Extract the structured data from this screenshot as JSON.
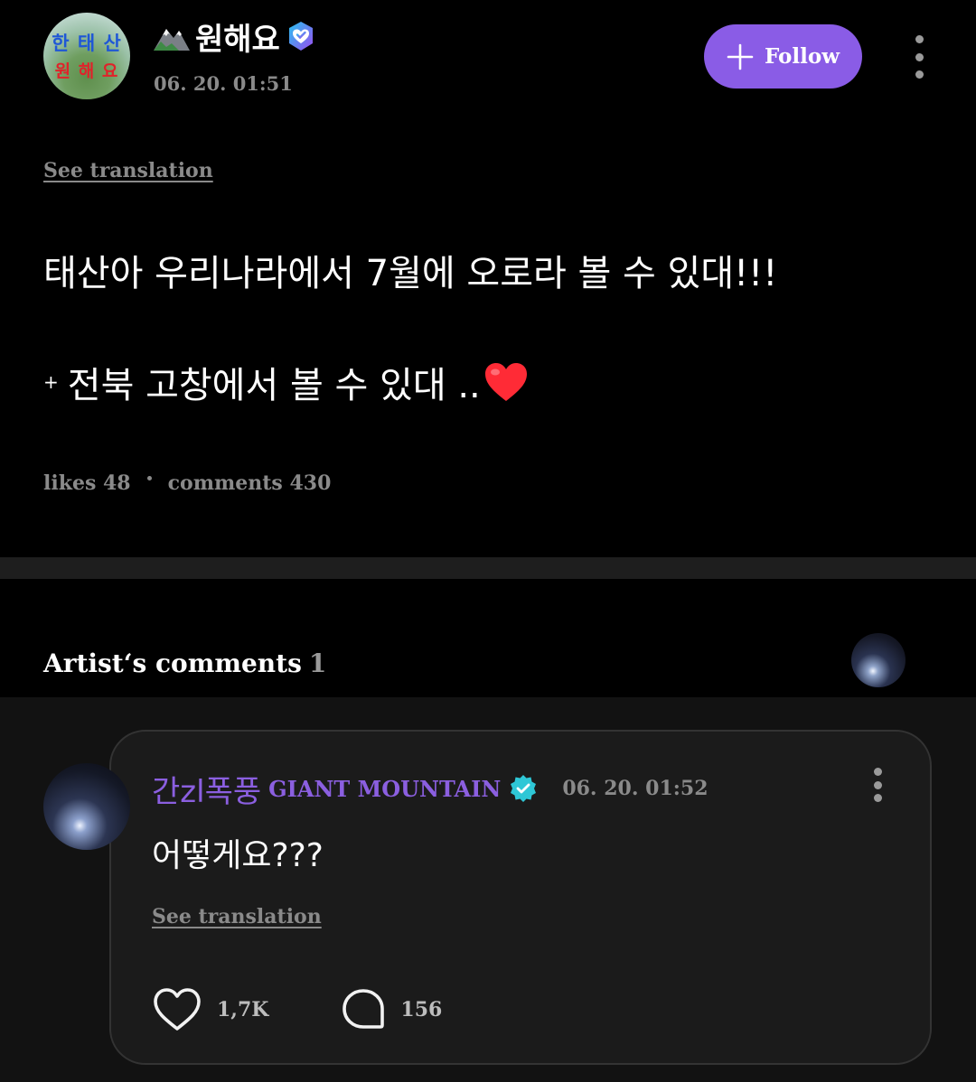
{
  "post": {
    "author": {
      "avatar_text_line1": "한 태 산",
      "avatar_text_line2": "원 해 요",
      "name_icon": "mountain-icon",
      "name": "원해요",
      "badge_icon": "verified-heart-badge-icon"
    },
    "timestamp": "06. 20. 01:51",
    "follow_button": {
      "icon": "plus-icon",
      "label": "Follow"
    },
    "see_translation": "See translation",
    "body_line1": "태산아 우리나라에서 7월에 오로라 볼 수 있대!!!",
    "body_line2_prefix": "+",
    "body_line2": "전북 고창에서 볼 수 있대 ..",
    "body_emoji": "red-heart-emoji",
    "likes_label": "likes 48",
    "comments_label": "comments 430"
  },
  "artist_comments": {
    "title": "Artist‘s comments",
    "count": "1"
  },
  "comment": {
    "author_name": "간zl폭풍",
    "author_group": "GIANT MOUNTAIN",
    "verified_icon": "verified-check-icon",
    "timestamp": "06. 20. 01:52",
    "text": "어떻게요???",
    "see_translation": "See translation",
    "like_count": "1,7K",
    "reply_count": "156"
  },
  "colors": {
    "background": "#000000",
    "accent_purple": "#8a5ce6",
    "muted_text": "#8a8a8a",
    "card_background": "#1b1b1b",
    "verified_teal": "#2ec7d6"
  }
}
